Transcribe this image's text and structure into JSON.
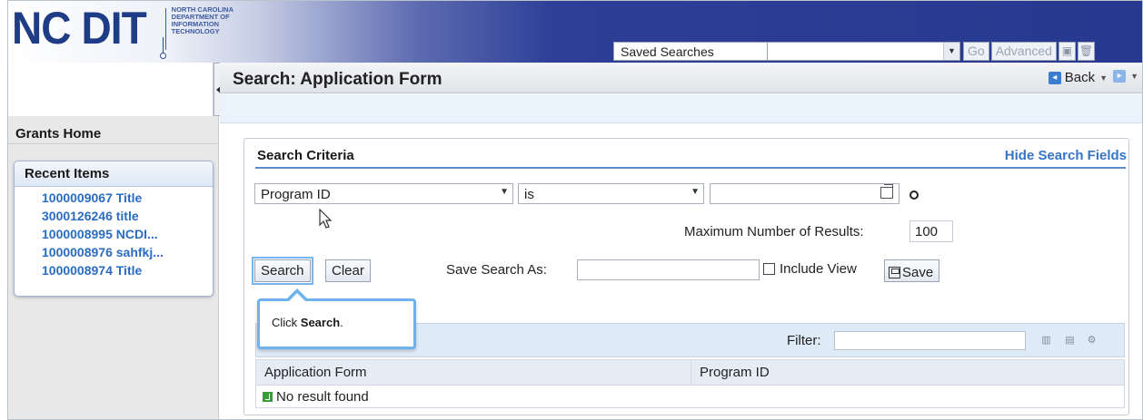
{
  "header": {
    "logo_text": "NC DIT",
    "logo_subtext": "NORTH CAROLINA\nDEPARTMENT OF\nINFORMATION\nTECHNOLOGY",
    "saved_searches_label": "Saved Searches",
    "saved_searches_value": "",
    "go_label": "Go",
    "advanced_label": "Advanced"
  },
  "sidebar": {
    "home_label": "Grants Home",
    "recent_title": "Recent Items",
    "recent_items": [
      {
        "label": "1000009067 Title"
      },
      {
        "label": "3000126246 title"
      },
      {
        "label": "1000008995 NCDI..."
      },
      {
        "label": "1000008976 sahfkj..."
      },
      {
        "label": "1000008974 Title"
      }
    ]
  },
  "main": {
    "page_title": "Search: Application Form",
    "back_label": "Back",
    "criteria_title": "Search Criteria",
    "hide_fields_label": "Hide Search Fields",
    "field_select": "Program ID",
    "operator_select": "is",
    "value_input": "",
    "max_results_label": "Maximum Number of Results:",
    "max_results_value": "100",
    "search_label": "Search",
    "clear_label": "Clear",
    "save_search_as_label": "Save Search As:",
    "save_search_as_value": "",
    "include_view_label": "Include View",
    "save_label": "Save",
    "callout_prefix": "Click ",
    "callout_bold": "Search",
    "callout_suffix": ".",
    "filter_label": "Filter:",
    "filter_value": "",
    "table": {
      "columns": [
        "Application Form",
        "Program ID"
      ],
      "empty_message": "No result found"
    }
  },
  "colors": {
    "header_blue": "#27388f",
    "link_blue": "#2a6cc2",
    "callout_border": "#6db2ea",
    "accent_rule": "#5c8bc9"
  }
}
